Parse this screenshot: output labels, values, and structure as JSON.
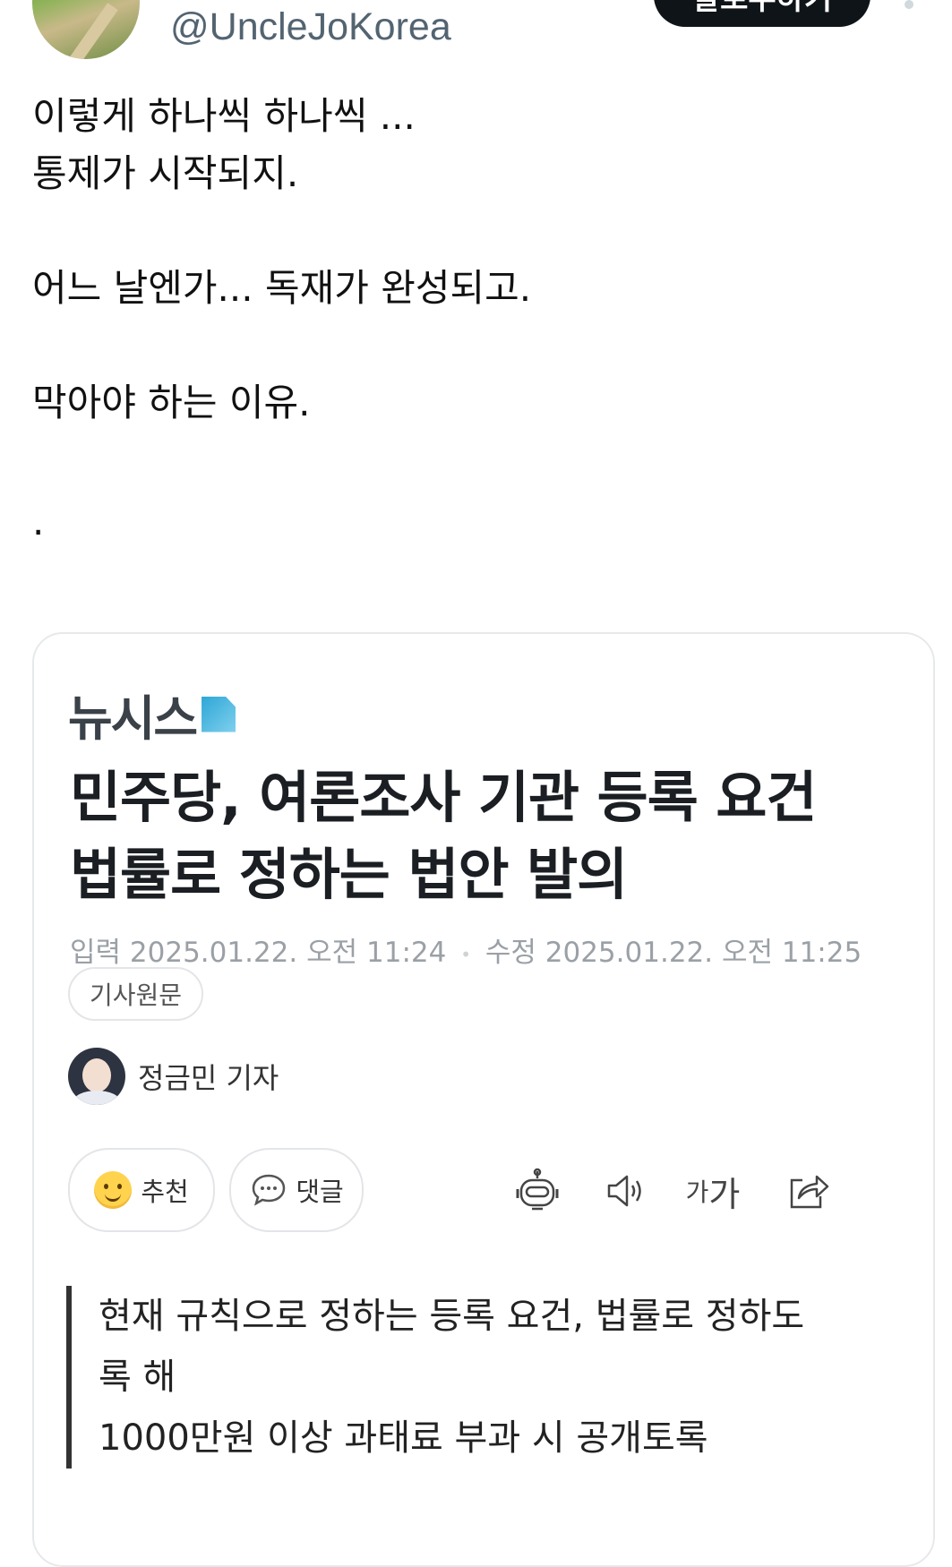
{
  "header": {
    "handle": "@UncleJoKorea",
    "follow_label": "팔로우하기"
  },
  "tweet": {
    "lines": [
      "이렇게 하나씩 하나씩 ...",
      "통제가 시작되지.",
      "어느 날엔가... 독재가 완성되고.",
      "막아야 하는 이유.",
      "."
    ]
  },
  "card": {
    "logo_text": "뉴시스",
    "headline_line1": "민주당, 여론조사 기관 등록 요건",
    "headline_line2": "법률로 정하는 법안 발의",
    "input_label": "입력",
    "input_time": "2025.01.22. 오전 11:24",
    "modified_label": "수정",
    "modified_time": "2025.01.22. 오전 11:25",
    "original_label": "기사원문",
    "reporter": "정금민 기자",
    "recommend_label": "추천",
    "comment_label": "댓글",
    "fontsize_small": "가",
    "fontsize_large": "가",
    "summary_line1": "현재 규칙으로 정하는 등록 요건, 법률로 정하도",
    "summary_line2": "록 해",
    "summary_line3": "1000만원 이상 과태료 부과 시 공개토록"
  }
}
